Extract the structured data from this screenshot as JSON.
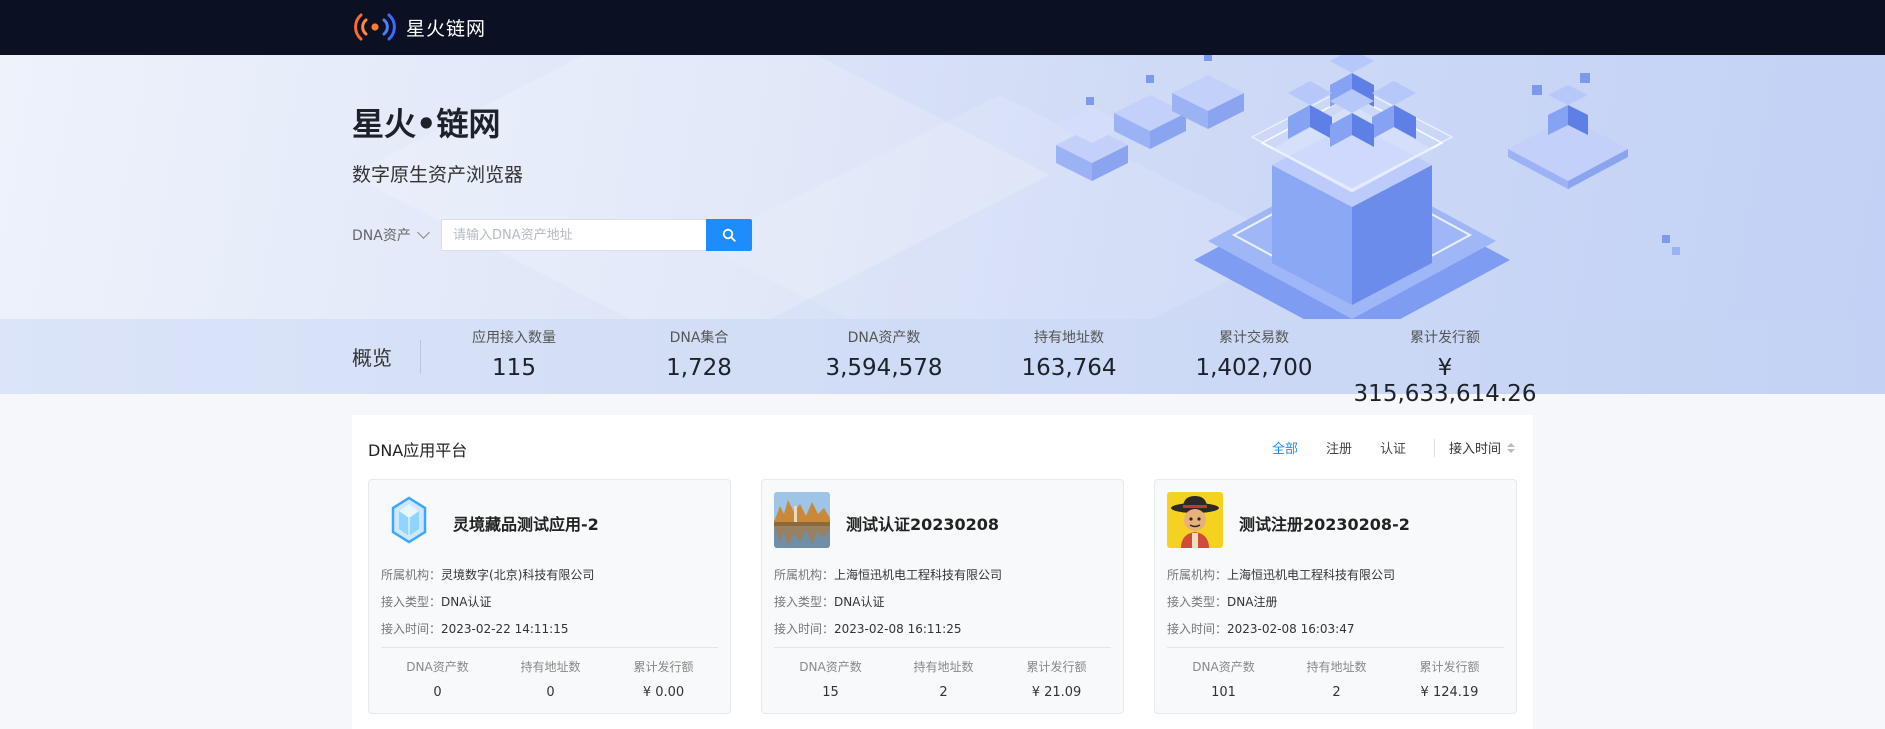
{
  "brand": {
    "name": "星火链网"
  },
  "hero": {
    "title": "星火•链网",
    "subtitle": "数字原生资产浏览器",
    "search_type": "DNA资产",
    "search_placeholder": "请输入DNA资产地址",
    "search_value": ""
  },
  "overview": {
    "title": "概览",
    "items": [
      {
        "label": "应用接入数量",
        "value": "115"
      },
      {
        "label": "DNA集合",
        "value": "1,728"
      },
      {
        "label": "DNA资产数",
        "value": "3,594,578"
      },
      {
        "label": "持有地址数",
        "value": "163,764"
      },
      {
        "label": "累计交易数",
        "value": "1,402,700"
      },
      {
        "label": "累计发行额",
        "value": "¥ 315,633,614.26"
      }
    ]
  },
  "apps": {
    "title": "DNA应用平台",
    "filters": [
      {
        "label": "全部",
        "active": true
      },
      {
        "label": "注册",
        "active": false
      },
      {
        "label": "认证",
        "active": false
      }
    ],
    "sort_label": "接入时间",
    "meta_labels": {
      "org": "所属机构：",
      "type": "接入类型：",
      "time": "接入时间："
    },
    "stat_labels": {
      "assets": "DNA资产数",
      "holders": "持有地址数",
      "issued": "累计发行额"
    },
    "cards": [
      {
        "name": "灵境藏品测试应用-2",
        "logo": "crystal-logo",
        "org": "灵境数字(北京)科技有限公司",
        "type": "DNA认证",
        "time": "2023-02-22 14:11:15",
        "assets": "0",
        "holders": "0",
        "issued": "¥  0.00"
      },
      {
        "name": "测试认证20230208",
        "logo": "landscape-logo",
        "org": "上海恒迅机电工程科技有限公司",
        "type": "DNA认证",
        "time": "2023-02-08 16:11:25",
        "assets": "15",
        "holders": "2",
        "issued": "¥  21.09"
      },
      {
        "name": "测试注册20230208-2",
        "logo": "cowboy-avatar-logo",
        "org": "上海恒迅机电工程科技有限公司",
        "type": "DNA注册",
        "time": "2023-02-08 16:03:47",
        "assets": "101",
        "holders": "2",
        "issued": "¥  124.19"
      }
    ]
  },
  "colors": {
    "topbar": "#0b1023",
    "accent": "#1f8cfb"
  }
}
